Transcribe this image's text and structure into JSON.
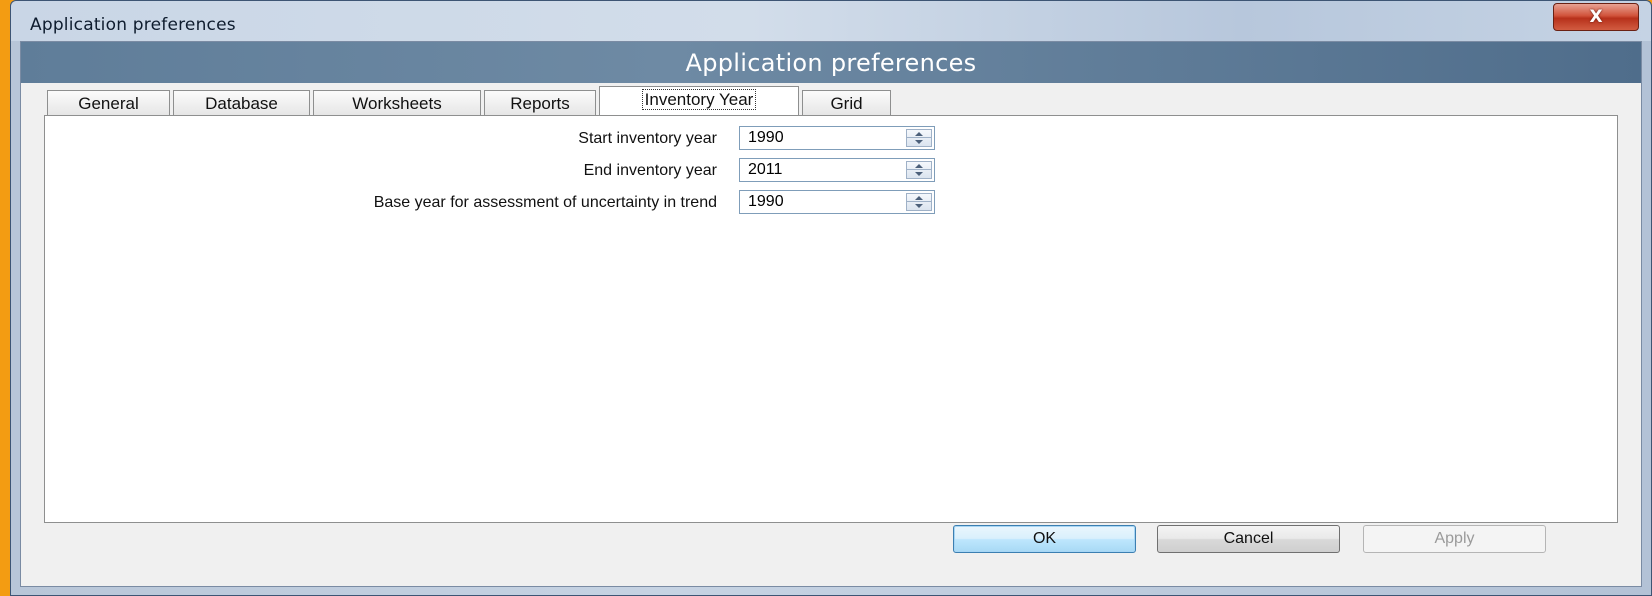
{
  "window": {
    "title": "Application preferences",
    "close_symbol": "X"
  },
  "banner": {
    "title": "Application preferences"
  },
  "tabs": [
    {
      "label": "General"
    },
    {
      "label": "Database"
    },
    {
      "label": "Worksheets"
    },
    {
      "label": "Reports"
    },
    {
      "label": "Inventory Year"
    },
    {
      "label": "Grid"
    }
  ],
  "active_tab": "Inventory Year",
  "fields": {
    "start": {
      "label": "Start inventory year",
      "value": "1990"
    },
    "end": {
      "label": "End inventory year",
      "value": "2011"
    },
    "base": {
      "label": "Base year for assessment of uncertainty in trend",
      "value": "1990"
    }
  },
  "buttons": {
    "ok": "OK",
    "cancel": "Cancel",
    "apply": "Apply"
  },
  "colors": {
    "background": "#f39c12",
    "banner": "#5f7d99",
    "close_button": "#c8452c"
  },
  "icons": {
    "close": "close-icon",
    "spin_up": "arrow-up-icon",
    "spin_down": "arrow-down-icon"
  }
}
